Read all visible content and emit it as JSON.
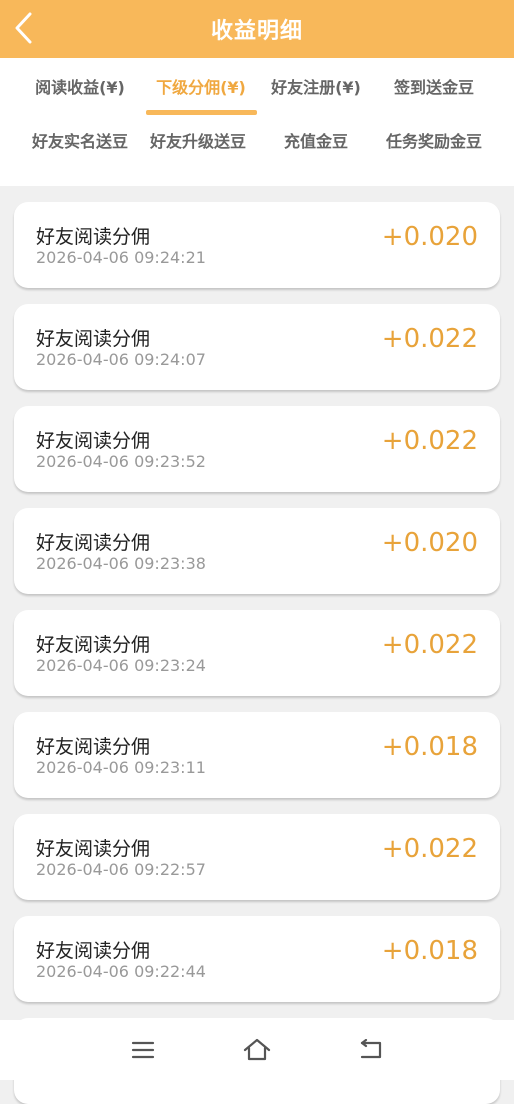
{
  "header": {
    "title": "收益明细"
  },
  "tabs": [
    {
      "label": "阅读收益(¥)",
      "active": false
    },
    {
      "label": "下级分佣(¥)",
      "active": true
    },
    {
      "label": "好友注册(¥)",
      "active": false
    },
    {
      "label": "签到送金豆",
      "active": false
    },
    {
      "label": "好友实名送豆",
      "active": false
    },
    {
      "label": "好友升级送豆",
      "active": false
    },
    {
      "label": "充值金豆",
      "active": false
    },
    {
      "label": "任务奖励金豆",
      "active": false
    }
  ],
  "records": [
    {
      "title": "好友阅读分佣",
      "time": "2026-04-06 09:24:21",
      "amount": "+0.020"
    },
    {
      "title": "好友阅读分佣",
      "time": "2026-04-06 09:24:07",
      "amount": "+0.022"
    },
    {
      "title": "好友阅读分佣",
      "time": "2026-04-06 09:23:52",
      "amount": "+0.022"
    },
    {
      "title": "好友阅读分佣",
      "time": "2026-04-06 09:23:38",
      "amount": "+0.020"
    },
    {
      "title": "好友阅读分佣",
      "time": "2026-04-06 09:23:24",
      "amount": "+0.022"
    },
    {
      "title": "好友阅读分佣",
      "time": "2026-04-06 09:23:11",
      "amount": "+0.018"
    },
    {
      "title": "好友阅读分佣",
      "time": "2026-04-06 09:22:57",
      "amount": "+0.022"
    },
    {
      "title": "好友阅读分佣",
      "time": "2026-04-06 09:22:44",
      "amount": "+0.018"
    }
  ],
  "colors": {
    "header_bg": "#f8b85a",
    "active_tab": "#f0a840",
    "amount": "#e8a33a"
  },
  "nav": {
    "back_icon": "chevron-left-icon",
    "menu_icon": "menu-icon",
    "home_icon": "home-icon",
    "return_icon": "return-icon"
  }
}
